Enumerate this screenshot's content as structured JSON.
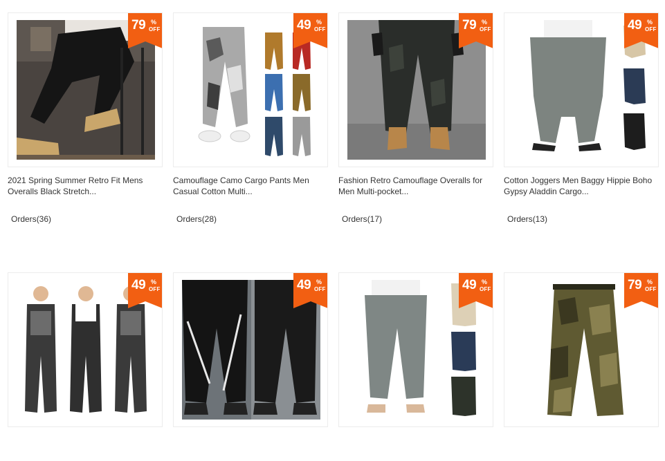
{
  "products": [
    {
      "title": "2021 Spring Summer Retro Fit Mens Overalls Black Stretch...",
      "orders_label": "Orders",
      "orders_count": "(36)",
      "discount": "79",
      "pct": "%",
      "off": "OFF",
      "image": "black-cargo-pants-photo"
    },
    {
      "title": "Camouflage Camo Cargo Pants Men Casual Cotton Multi...",
      "orders_label": "Orders",
      "orders_count": "(28)",
      "discount": "49",
      "pct": "%",
      "off": "OFF",
      "image": "camo-joggers-color-variants-photo"
    },
    {
      "title": "Fashion Retro Camouflage Overalls for Men Multi-pocket...",
      "orders_label": "Orders",
      "orders_count": "(17)",
      "discount": "79",
      "pct": "%",
      "off": "OFF",
      "image": "dark-camo-pants-boots-photo"
    },
    {
      "title": "Cotton Joggers Men Baggy Hippie Boho Gypsy Aladdin Cargo...",
      "orders_label": "Orders",
      "orders_count": "(13)",
      "discount": "49",
      "pct": "%",
      "off": "OFF",
      "image": "harem-pants-variants-photo"
    },
    {
      "title": "",
      "orders_label": "",
      "orders_count": "",
      "discount": "49",
      "pct": "%",
      "off": "OFF",
      "image": "work-overalls-three-men-photo"
    },
    {
      "title": "",
      "orders_label": "",
      "orders_count": "",
      "discount": "49",
      "pct": "%",
      "off": "OFF",
      "image": "reflective-stripe-joggers-photo"
    },
    {
      "title": "",
      "orders_label": "",
      "orders_count": "",
      "discount": "49",
      "pct": "%",
      "off": "OFF",
      "image": "linen-pants-variants-photo"
    },
    {
      "title": "",
      "orders_label": "",
      "orders_count": "",
      "discount": "79",
      "pct": "%",
      "off": "OFF",
      "image": "olive-camo-cargo-pants-photo"
    }
  ],
  "colors": {
    "badge": "#f25f12",
    "text": "#333333",
    "border": "#ececec"
  }
}
